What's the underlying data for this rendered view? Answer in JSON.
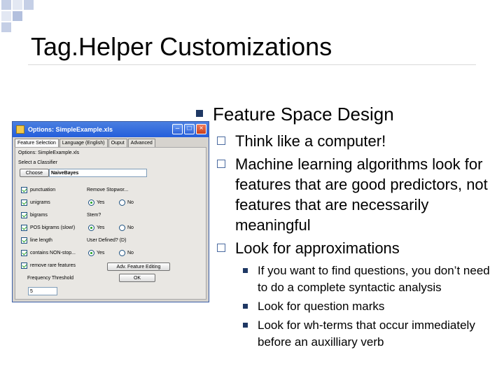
{
  "slide": {
    "title": "Tag.Helper Customizations",
    "bullet": "Feature Space Design",
    "sub_bullets": [
      "Think like a computer!",
      "Machine learning algorithms look for features that are good predictors, not features that are necessarily meaningful",
      "Look for approximations"
    ],
    "sub_sub_bullets": [
      "If you want to find questions, you don’t need to do a complete syntactic analysis",
      "Look for question marks",
      "Look for wh-terms that occur immediately before an auxilliary verb"
    ]
  },
  "window": {
    "title": "Options: SimpleExample.xls",
    "tabs": [
      "Feature Selection",
      "Language (English)",
      "Ouput",
      "Advanced"
    ],
    "options_label": "Options: SimpleExample.xls",
    "classifier_label": "Select a Classifier",
    "choose_label": "Choose",
    "classifier_value": "NaiveBayes",
    "features": [
      {
        "label": "punctuation",
        "checked": true
      },
      {
        "label": "unigrams",
        "checked": true
      },
      {
        "label": "bigrams",
        "checked": true
      },
      {
        "label": "POS bigrams (slow!)",
        "checked": true
      },
      {
        "label": "line length",
        "checked": true
      },
      {
        "label": "contains NON-stop...",
        "checked": true
      },
      {
        "label": "remove rare features",
        "checked": true
      }
    ],
    "remove_stopwords_label": "Remove Stopwor...",
    "stem_label": "Stem?",
    "user_defined_label": "User Defined? (D)",
    "yes_label": "Yes",
    "no_label": "No",
    "adv_button": "Adv. Feature Editing",
    "ok_button": "OK",
    "frequency_label": "Frequency Threshold",
    "frequency_value": "5"
  }
}
